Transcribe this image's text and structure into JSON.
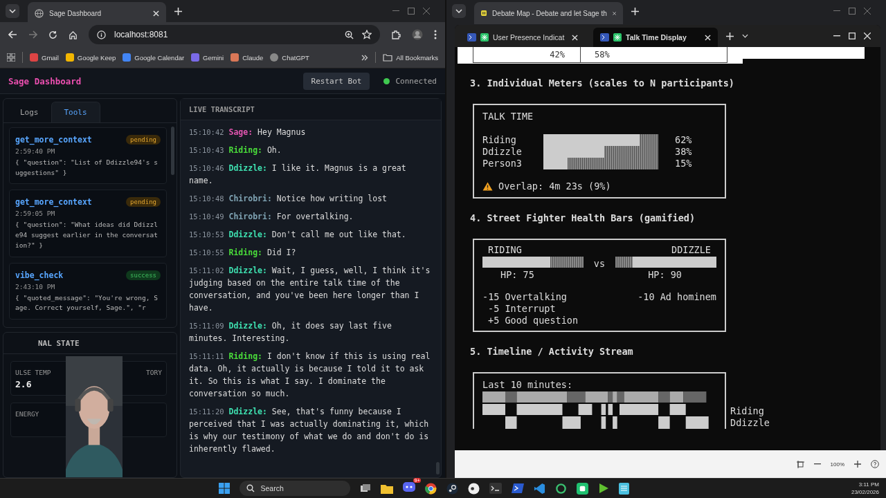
{
  "left_browser": {
    "tab": {
      "title": "Sage Dashboard"
    },
    "address": "localhost:8081",
    "bookmarks": [
      "Gmail",
      "Google Keep",
      "Google Calendar",
      "Gemini",
      "Claude",
      "ChatGPT"
    ],
    "all_bookmarks": "All Bookmarks"
  },
  "dashboard": {
    "title": "Sage Dashboard",
    "restart_button": "Restart Bot",
    "connection": {
      "label": "Connected",
      "connected": true
    },
    "panel_tabs": [
      {
        "label": "Logs",
        "selected": false
      },
      {
        "label": "Tools",
        "selected": true
      }
    ],
    "tool_calls": [
      {
        "name": "get_more_context",
        "status": "pending",
        "kind": "waiting",
        "time": "2:59:40 PM",
        "args": "{ \"question\": \"List of Ddizzle94's suggestions\" }"
      },
      {
        "name": "get_more_context",
        "status": "pending",
        "kind": "waiting",
        "time": "2:59:05 PM",
        "args": "{ \"question\": \"What ideas did Ddizzle94 suggest earlier in the conversation?\" }"
      },
      {
        "name": "vibe_check",
        "status": "success",
        "kind": "done",
        "time": "2:43:10 PM",
        "args": "{ \"quoted_message\": \"You're wrong, Sage. Correct yourself, Sage.\", \"r"
      }
    ],
    "internal_state": {
      "title": "NAL STATE",
      "metrics": [
        {
          "label": "ULSE TEMP",
          "value": "2.6"
        },
        {
          "label": "TORY"
        },
        {
          "label": "ENERGY"
        }
      ]
    },
    "transcript": {
      "title": "LIVE TRANSCRIPT",
      "entries": [
        {
          "time": "15:10:42",
          "speaker": "Sage:",
          "color": "#e255b0",
          "text": "Hey Magnus"
        },
        {
          "time": "15:10:43",
          "speaker": "Riding:",
          "color": "#4ade3a",
          "text": "Oh."
        },
        {
          "time": "15:10:46",
          "speaker": "Ddizzle:",
          "color": "#3ee0b0",
          "text": "I like it. Magnus is a great name."
        },
        {
          "time": "15:10:48",
          "speaker": "Chirobri:",
          "color": "#7fa3b3",
          "text": "Notice how writing lost"
        },
        {
          "time": "15:10:49",
          "speaker": "Chirobri:",
          "color": "#7fa3b3",
          "text": "For overtalking."
        },
        {
          "time": "15:10:53",
          "speaker": "Ddizzle:",
          "color": "#3ee0b0",
          "text": "Don't call me out like that."
        },
        {
          "time": "15:10:55",
          "speaker": "Riding:",
          "color": "#4ade3a",
          "text": "Did I?"
        },
        {
          "time": "15:11:02",
          "speaker": "Ddizzle:",
          "color": "#3ee0b0",
          "text": "Wait, I guess, well, I think it's judging based on the entire talk time of the conversation, and you've been here longer than I have."
        },
        {
          "time": "15:11:09",
          "speaker": "Ddizzle:",
          "color": "#3ee0b0",
          "text": "Oh, it does say last five minutes. Interesting."
        },
        {
          "time": "15:11:11",
          "speaker": "Riding:",
          "color": "#4ade3a",
          "text": "I don't know if this is using real data. Oh, it actually is because I told it to ask it. So this is what I say. I dominate the conversation so much."
        },
        {
          "time": "15:11:20",
          "speaker": "Ddizzle:",
          "color": "#3ee0b0",
          "text": "See, that's funny because I perceived that I was actually dominating it, which is why our testimony of what we do and don't do is inherently flawed."
        }
      ]
    }
  },
  "right_browser": {
    "tab": {
      "title": "Debate Map - Debate and let Sage th"
    },
    "inner_tabs": [
      {
        "title": "User Presence Indicat",
        "selected": false
      },
      {
        "title": "Talk Time Display",
        "selected": true
      }
    ],
    "document": {
      "split": [
        "42%",
        "58%"
      ],
      "sections": [
        {
          "kind": "meters",
          "heading": "3. Individual Meters (scales to N participants)",
          "title": "TALK TIME",
          "warning": "Overlap: 4m 23s (9%)",
          "rows": [
            {
              "name": "Riding",
              "level": 0.84,
              "reading": "62%"
            },
            {
              "name": "Ddizzle",
              "level": 0.53,
              "reading": "38%"
            },
            {
              "name": "Person3",
              "level": 0.21,
              "reading": "15%"
            }
          ]
        },
        {
          "kind": "health",
          "heading": "4. Street Fighter Health Bars (gamified)",
          "vs": "vs",
          "fighters": [
            {
              "name": "RIDING",
              "level": 0.67,
              "hp": "HP: 75",
              "events": [
                "-15 Overtalking",
                "-5 Interrupt",
                "+5 Good question"
              ]
            },
            {
              "name": "DDIZZLE",
              "level": 0.83,
              "hp": "HP: 90",
              "events": [
                "-10 Ad hominem"
              ]
            }
          ]
        },
        {
          "kind": "timeline",
          "heading": "5. Timeline / Activity Stream",
          "title": "Last 10 minutes:",
          "legend": [
            "Riding",
            "Ddizzle"
          ]
        }
      ]
    },
    "zoom": "100%"
  },
  "taskbar": {
    "search": "Search",
    "badge": "9+",
    "time": "3:11 PM",
    "date": "23/02/2026"
  }
}
